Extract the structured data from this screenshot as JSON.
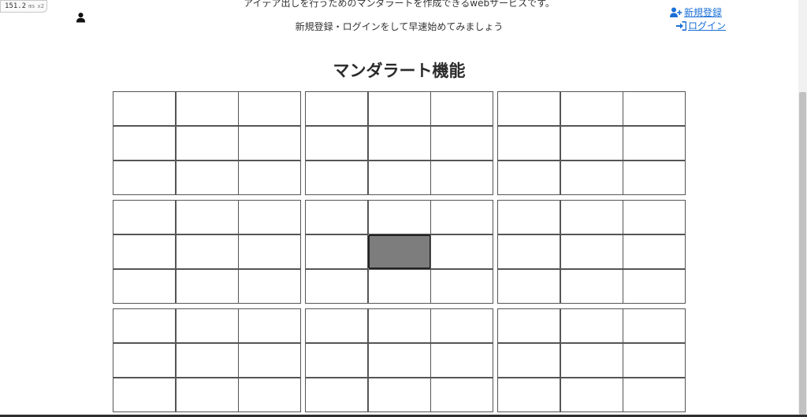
{
  "perf": {
    "value": "151.2",
    "unit": "ms",
    "multiplier": "x2"
  },
  "header": {
    "tagline_line1": "アイデア出しを行うためのマンダラートを作成できるwebサービスです。",
    "tagline_line2": "新規登録・ログインをして早速始めてみましょう",
    "register_label": "新規登録",
    "login_label": "ログイン"
  },
  "main": {
    "title": "マンダラート機能"
  },
  "colors": {
    "link": "#1a6fd6",
    "center_cell": "#7d7d7d",
    "cell_border": "#555555"
  }
}
